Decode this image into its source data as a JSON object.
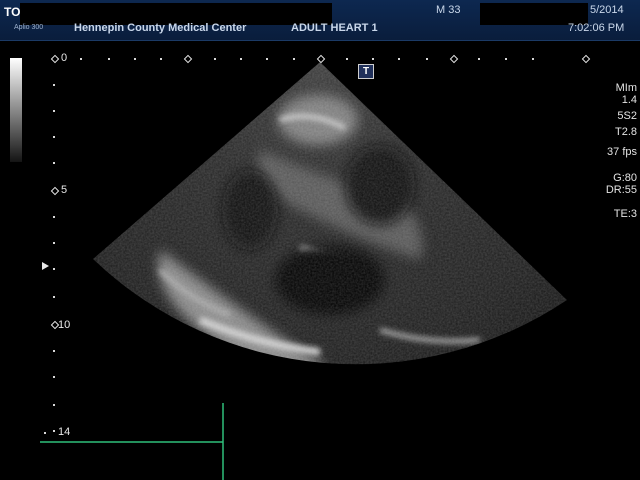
{
  "header": {
    "model": "TO",
    "system_tag": "Aplio 300",
    "institution": "Hennepin County Medical Center",
    "preset": "ADULT HEART 1",
    "age_sex": "M 33",
    "date": "5/2014",
    "time": "7:02:06 PM"
  },
  "depth_scale": {
    "labels": [
      "0",
      "5",
      "10",
      "14"
    ]
  },
  "marker": {
    "label": "T"
  },
  "parameters": {
    "mi_label": "MIm",
    "mi_value": "1.4",
    "probe": "5S2",
    "tis": "T2.8",
    "frame_rate": "37 fps",
    "gain": "G:80",
    "dynamic_range": "DR:55",
    "te": "TE:3"
  },
  "colors": {
    "header_bg": "#0d2850",
    "caliper": "#2fbf7a",
    "text": "#e6e6e6"
  }
}
